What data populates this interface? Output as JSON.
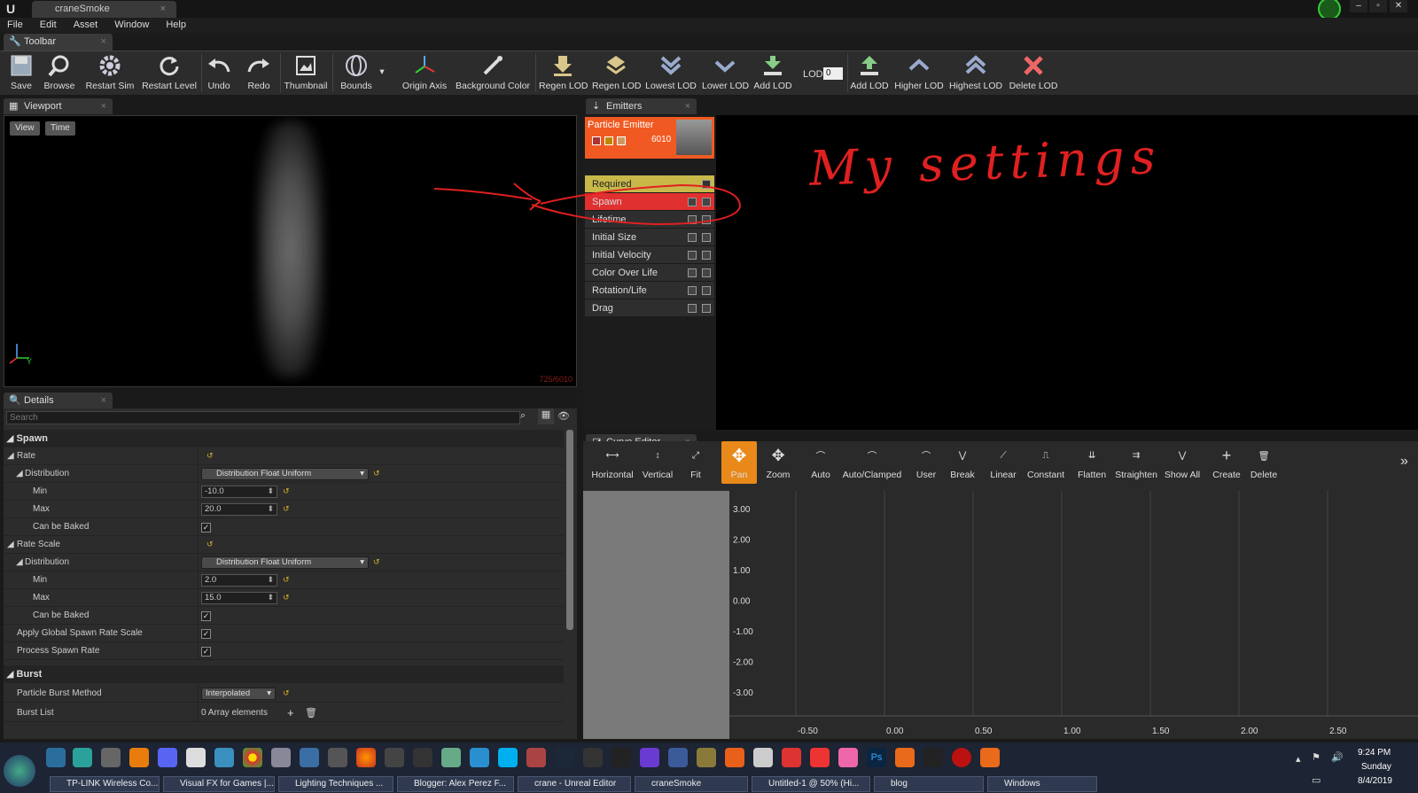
{
  "app": {
    "doc_tab": "craneSmoke",
    "menu": [
      "File",
      "Edit",
      "Asset",
      "Window",
      "Help"
    ]
  },
  "toolbar": {
    "tab": "Toolbar",
    "buttons": [
      "Save",
      "Browse",
      "Restart Sim",
      "Restart Level",
      "Undo",
      "Redo",
      "Thumbnail",
      "Bounds",
      "Origin Axis",
      "Background Color",
      "Regen LOD",
      "Regen LOD",
      "Lowest LOD",
      "Lower LOD",
      "Add LOD",
      "Add LOD",
      "Higher LOD",
      "Highest LOD",
      "Delete LOD"
    ],
    "lod_label": "LOD:",
    "lod_value": "0"
  },
  "viewport": {
    "tab": "Viewport",
    "view_btn": "View",
    "time_btn": "Time",
    "stat": "725/6010",
    "axis_y": "Y"
  },
  "details": {
    "tab": "Details",
    "search_placeholder": "Search",
    "spawn_header": "Spawn",
    "rate": "Rate",
    "distribution": "Distribution",
    "dist_value": "Distribution Float Uniform",
    "min": "Min",
    "max": "Max",
    "rate_min": "-10.0",
    "rate_max": "20.0",
    "can_be_baked": "Can be Baked",
    "rate_scale": "Rate Scale",
    "scale_min": "2.0",
    "scale_max": "15.0",
    "apply_global": "Apply Global Spawn Rate Scale",
    "process_spawn": "Process Spawn Rate",
    "burst_header": "Burst",
    "burst_method": "Particle Burst Method",
    "burst_method_value": "Interpolated",
    "burst_list": "Burst List",
    "burst_list_value": "0 Array elements"
  },
  "emitters": {
    "tab": "Emitters",
    "emitter_name": "Particle Emitter",
    "emitter_count": "6010",
    "modules": [
      "Required",
      "Spawn",
      "Lifetime",
      "Initial Size",
      "Initial Velocity",
      "Color Over Life",
      "Rotation/Life",
      "Drag"
    ],
    "annotation": "My settings"
  },
  "curve_editor": {
    "tab": "Curve Editor",
    "buttons": [
      "Horizontal",
      "Vertical",
      "Fit",
      "Pan",
      "Zoom",
      "Auto",
      "Auto/Clamped",
      "User",
      "Break",
      "Linear",
      "Constant",
      "Flatten",
      "Straighten",
      "Show All",
      "Create",
      "Delete"
    ],
    "y_labels": [
      "3.00",
      "2.00",
      "1.00",
      "0.00",
      "-1.00",
      "-2.00",
      "-3.00"
    ],
    "x_labels": [
      "-0.50",
      "0.00",
      "0.50",
      "1.00",
      "1.50",
      "2.00",
      "2.50"
    ]
  },
  "taskbar": {
    "tasks": [
      "TP-LINK Wireless Co...",
      "Visual FX for Games |...",
      "Lighting Techniques ...",
      "Blogger: Alex Perez F...",
      "crane - Unreal Editor",
      "craneSmoke",
      "Untitled-1 @ 50% (Hi...",
      "blog",
      "Windows"
    ],
    "time": "9:24 PM",
    "day": "Sunday",
    "date": "8/4/2019"
  },
  "colors": {
    "emitter_orange": "#f05a22",
    "spawn_red": "#e03030",
    "required_yellow": "#c8b84a",
    "annotation_red": "#e02020",
    "pan_active": "#e8891a"
  }
}
